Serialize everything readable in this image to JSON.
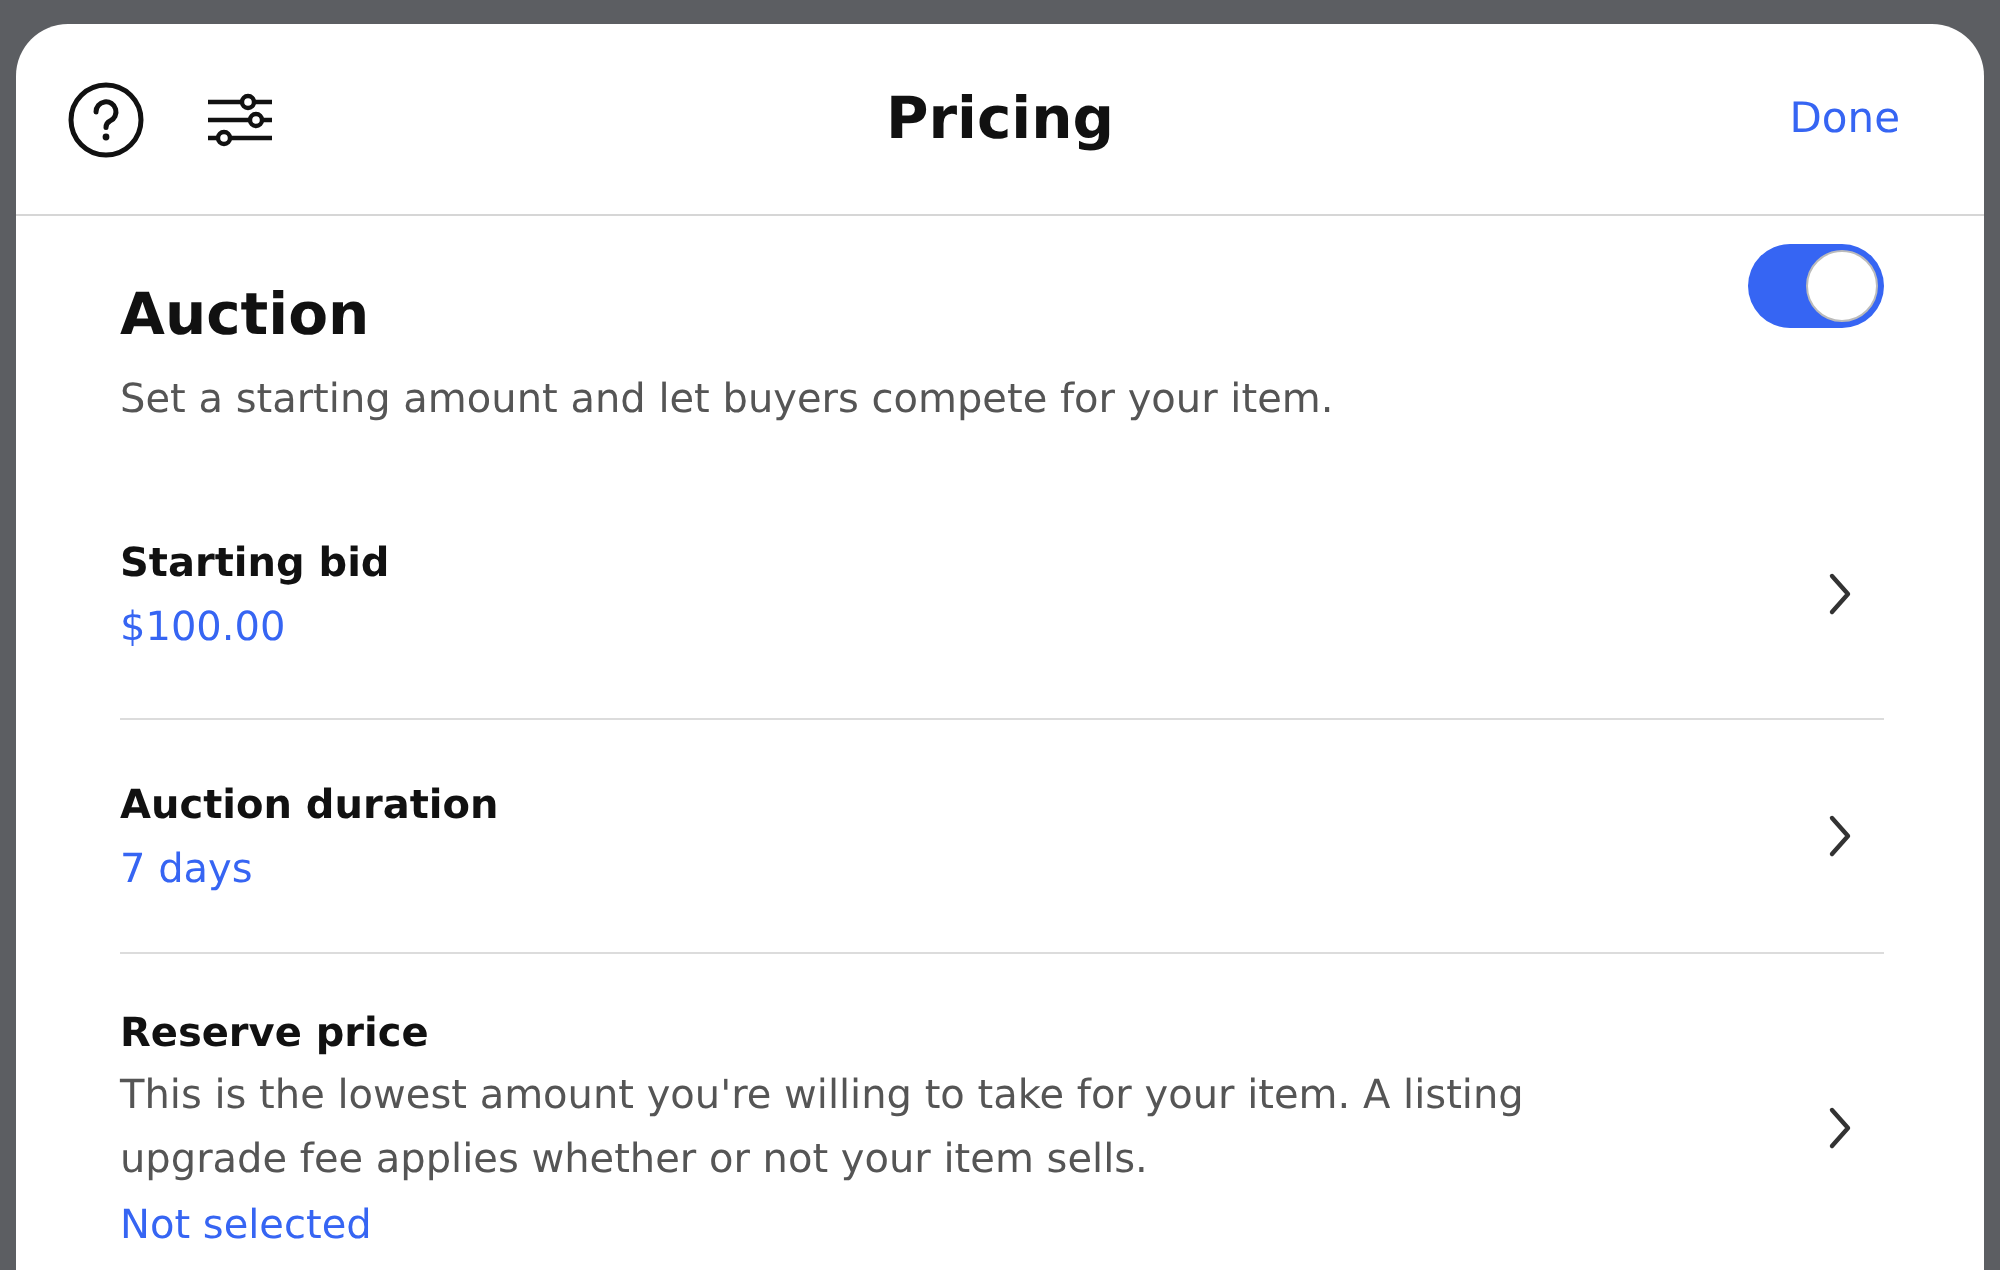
{
  "header": {
    "title": "Pricing",
    "done": "Done"
  },
  "auction": {
    "title": "Auction",
    "description": "Set a starting amount and let buyers compete for your item.",
    "on": true
  },
  "rows": [
    {
      "label": "Starting bid",
      "value": "$100.00"
    },
    {
      "label": "Auction duration",
      "value": "7 days"
    },
    {
      "label": "Reserve price",
      "description": "This is the lowest amount you're willing to take for your item. A listing upgrade fee applies whether or not your item sells.",
      "value": "Not selected"
    }
  ]
}
